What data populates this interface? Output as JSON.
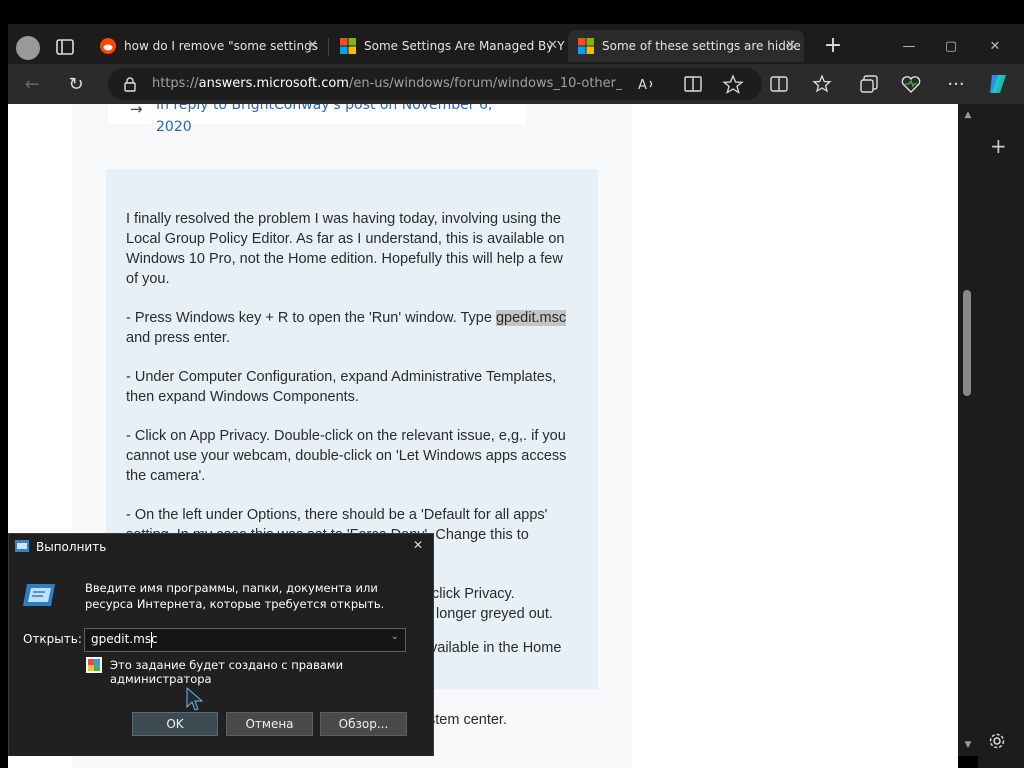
{
  "tabs": [
    {
      "title": "how do I remove \"some settings",
      "favicon": "reddit-icon",
      "active": false
    },
    {
      "title": "Some Settings Are Managed By Y",
      "favicon": "microsoft-icon",
      "active": false
    },
    {
      "title": "Some of these settings are hidde",
      "favicon": "microsoft-icon",
      "active": true
    }
  ],
  "address": {
    "scheme": "https://",
    "host": "answers.microsoft.com",
    "path": "/en-us/windows/forum/windows_10-other_..."
  },
  "page": {
    "reply_to": "In reply to BrightConway's post on November 6, 2020",
    "answer_paragraphs": [
      {
        "before": "I finally resolved the problem I was having today, involving using the Local Group Policy Editor.  As far as I understand, this is available on Windows 10 Pro, not the Home edition.  Hopefully this will help a few of you.",
        "highlight": "",
        "after": ""
      },
      {
        "before": "- Press Windows key + R to open the 'Run' window.  Type ",
        "highlight": "gpedit.msc",
        "after": " and press enter."
      },
      {
        "before": "- Under Computer Configuration, expand Administrative Templates, then expand Windows Components.",
        "highlight": "",
        "after": ""
      },
      {
        "before": "- Click on App Privacy.  Double-click on the relevant issue, e,g,. if you cannot use your webcam, double-click on 'Let Windows apps access the camera'.",
        "highlight": "",
        "after": ""
      },
      {
        "before": "- On the left under Options, there should be a 'Default for all apps' setting.  In my case this was set to 'Force Deny'.  Change this to",
        "highlight": "",
        "after": ""
      }
    ],
    "partial_lines": [
      "click Privacy.",
      "longer greyed out.",
      "vailable in the Home"
    ],
    "after_text": "stem center."
  },
  "run_dialog": {
    "title": "Выполнить",
    "description": "Введите имя программы, папки, документа или ресурса Интернета, которые требуется открыть.",
    "open_label": "Открыть:",
    "input_value": "gpedit.msc",
    "admin_note": "Это задание будет создано с правами администратора",
    "ok_label": "OK",
    "cancel_label": "Отмена",
    "browse_label": "Обзор..."
  }
}
